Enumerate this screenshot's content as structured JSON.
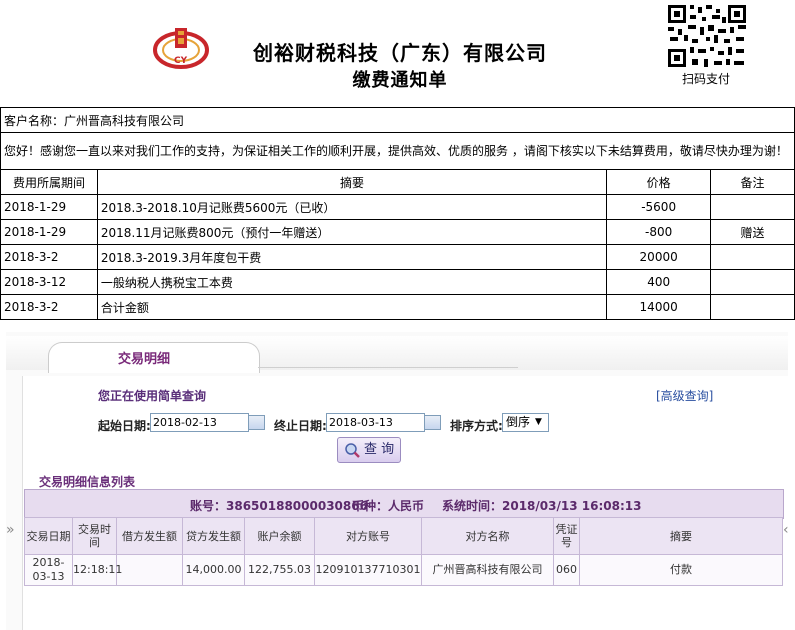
{
  "header": {
    "company_name": "创裕财税科技（广东）有限公司",
    "doc_title": "缴费通知单",
    "logo_text": "CY",
    "qr_label": "扫码支付"
  },
  "invoice": {
    "customer_row": "客户名称：广州晋高科技有限公司",
    "note": "您好！感谢您一直以来对我们工作的支持，为保证相关工作的顺利开展，提供高效、优质的服务 ，请阁下核实以下未结算费用，敬请尽快办理为谢！",
    "headers": [
      "费用所属期间",
      "摘要",
      "价格",
      "备注"
    ],
    "rows": [
      {
        "period": "2018-1-29",
        "summary": "2018.3-2018.10月记账费5600元（已收）",
        "price": "-5600",
        "remark": ""
      },
      {
        "period": "2018-1-29",
        "summary": "2018.11月记账费800元（预付一年赠送）",
        "price": "-800",
        "remark": "赠送"
      },
      {
        "period": "2018-3-2",
        "summary": "2018.3-2019.3月年度包干费",
        "price": "20000",
        "remark": ""
      },
      {
        "period": "2018-3-12",
        "summary": "一般纳税人携税宝工本费",
        "price": "400",
        "remark": ""
      },
      {
        "period": "2018-3-2",
        "summary": "合计金额",
        "price": "14000",
        "remark": ""
      }
    ]
  },
  "bank": {
    "tab_label": "交易明细",
    "query_title": "您正在使用简单查询",
    "advanced_link": "[高级查询]",
    "start_label": "起始日期:",
    "start_value": "2018-02-13",
    "end_label": "终止日期:",
    "end_value": "2018-03-13",
    "sort_label": "排序方式:",
    "sort_value": "倒序",
    "search_button": "查 询",
    "list_title": "交易明细信息列表",
    "account": "账号：38650188000030866",
    "currency": "币种：人民币",
    "system_time": "系统时间：2018/03/13 16:08:13",
    "columns": [
      "交易日期",
      "交易时间",
      "借方发生额",
      "贷方发生额",
      "账户余额",
      "对方账号",
      "对方名称",
      "凭证号",
      "摘要"
    ],
    "rows": [
      {
        "date": "2018-03-13",
        "time": "12:18:11",
        "debit": "",
        "credit": "14,000.00",
        "balance": "122,755.03",
        "counter_account": "120910137710301",
        "counter_name": "广州晋高科技有限公司",
        "voucher": "060",
        "summary": "付款"
      }
    ]
  },
  "colors": {
    "accent_purple": "#5b2a6b",
    "header_bg": "#e7dcef",
    "logo_red": "#c8262b"
  }
}
